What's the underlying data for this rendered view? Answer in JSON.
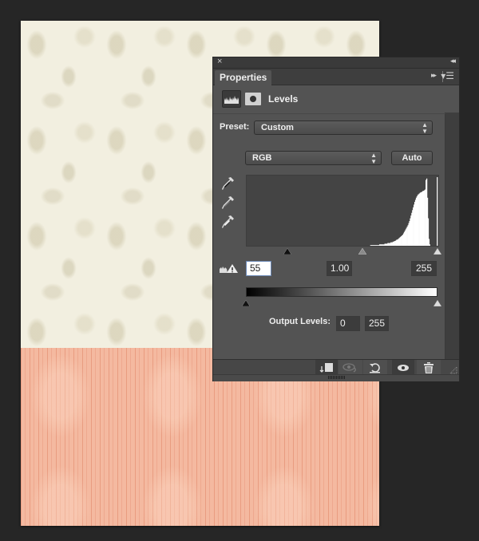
{
  "document": {
    "top_layer": "damask-pattern",
    "bottom_layer": "wood-grain-pattern",
    "colors": {
      "background": "#262626",
      "damask": "#f2efe0",
      "wood": "#f4b9a0"
    }
  },
  "panel": {
    "title_close": "×",
    "title_collapse": "◂◂",
    "tab": "Properties",
    "tab_more": "▸▸",
    "tab_menu": "▾☰",
    "layer_title": "Levels",
    "preset_label": "Preset:",
    "preset_value": "Custom",
    "channel_value": "RGB",
    "auto_label": "Auto",
    "input_levels": {
      "black": "55",
      "gamma": "1.00",
      "white": "255"
    },
    "input_sliders": {
      "black": 55,
      "gamma": 1.0,
      "white": 255
    },
    "output_label": "Output Levels:",
    "output_levels": {
      "black": "0",
      "white": "255"
    },
    "output_sliders": {
      "black": 0,
      "white": 255
    },
    "histogram": {
      "bins_start": 160,
      "values": [
        0,
        0,
        0,
        0,
        0,
        1,
        1,
        1,
        1,
        1,
        1,
        1,
        1,
        1,
        1,
        1,
        1,
        2,
        2,
        2,
        2,
        2,
        2,
        2,
        3,
        3,
        3,
        3,
        4,
        4,
        4,
        4,
        5,
        5,
        5,
        6,
        6,
        7,
        7,
        8,
        9,
        9,
        10,
        11,
        12,
        13,
        14,
        15,
        16,
        18,
        20,
        22,
        24,
        26,
        28,
        30,
        33,
        36,
        40,
        44,
        48,
        52,
        56,
        60,
        64,
        67,
        70,
        72,
        74,
        75,
        76,
        77,
        78,
        78,
        79,
        80,
        80,
        81,
        82,
        96,
        98,
        70,
        40,
        10,
        2,
        0,
        0,
        0,
        0,
        0,
        0,
        0,
        0,
        0,
        100
      ]
    },
    "footer_buttons": [
      "clip-to-layer",
      "view-previous-state",
      "reset",
      "toggle-visibility",
      "delete"
    ]
  }
}
